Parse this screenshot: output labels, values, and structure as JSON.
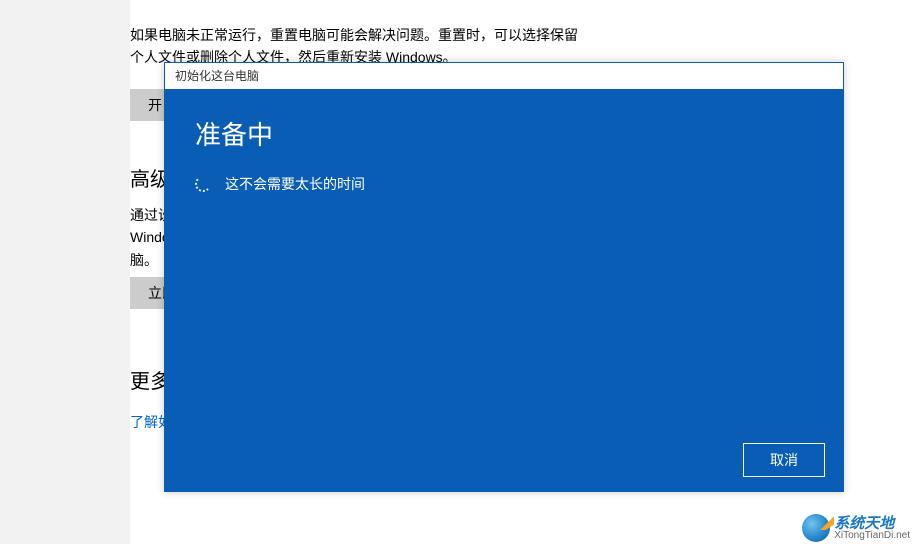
{
  "background": {
    "desc_line1": "如果电脑未正常运行，重置电脑可能会解决问题。重置时，可以选择保留",
    "desc_line2": "个人文件或删除个人文件，然后重新安装 Windows。",
    "btn_reset_partial": "开",
    "advanced_heading_partial": "高级",
    "adv_line1": "通过设",
    "adv_line2": "Windo",
    "adv_line3": "脑。",
    "btn_adv_partial": "立即",
    "more_heading_partial": "更多",
    "link_partial": "了解如"
  },
  "modal": {
    "titlebar": "初始化这台电脑",
    "heading": "准备中",
    "progress_text": "这不会需要太长的时间",
    "cancel_label": "取消"
  },
  "watermark": {
    "line1": "系统天地",
    "line2": "XiTongTianDi.net"
  }
}
